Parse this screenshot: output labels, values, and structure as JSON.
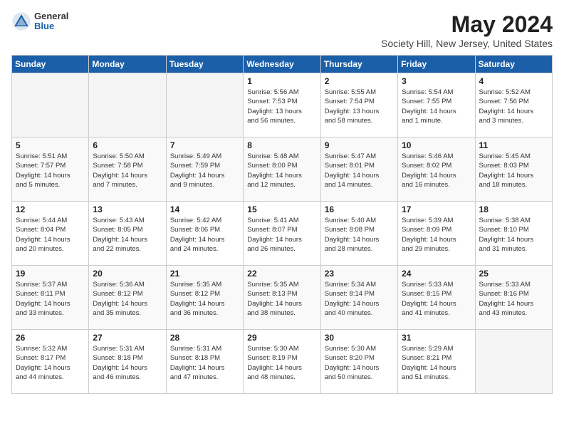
{
  "header": {
    "logo_line1": "General",
    "logo_line2": "Blue",
    "month_year": "May 2024",
    "location": "Society Hill, New Jersey, United States"
  },
  "days_of_week": [
    "Sunday",
    "Monday",
    "Tuesday",
    "Wednesday",
    "Thursday",
    "Friday",
    "Saturday"
  ],
  "weeks": [
    [
      {
        "day": "",
        "info": ""
      },
      {
        "day": "",
        "info": ""
      },
      {
        "day": "",
        "info": ""
      },
      {
        "day": "1",
        "info": "Sunrise: 5:56 AM\nSunset: 7:53 PM\nDaylight: 13 hours\nand 56 minutes."
      },
      {
        "day": "2",
        "info": "Sunrise: 5:55 AM\nSunset: 7:54 PM\nDaylight: 13 hours\nand 58 minutes."
      },
      {
        "day": "3",
        "info": "Sunrise: 5:54 AM\nSunset: 7:55 PM\nDaylight: 14 hours\nand 1 minute."
      },
      {
        "day": "4",
        "info": "Sunrise: 5:52 AM\nSunset: 7:56 PM\nDaylight: 14 hours\nand 3 minutes."
      }
    ],
    [
      {
        "day": "5",
        "info": "Sunrise: 5:51 AM\nSunset: 7:57 PM\nDaylight: 14 hours\nand 5 minutes."
      },
      {
        "day": "6",
        "info": "Sunrise: 5:50 AM\nSunset: 7:58 PM\nDaylight: 14 hours\nand 7 minutes."
      },
      {
        "day": "7",
        "info": "Sunrise: 5:49 AM\nSunset: 7:59 PM\nDaylight: 14 hours\nand 9 minutes."
      },
      {
        "day": "8",
        "info": "Sunrise: 5:48 AM\nSunset: 8:00 PM\nDaylight: 14 hours\nand 12 minutes."
      },
      {
        "day": "9",
        "info": "Sunrise: 5:47 AM\nSunset: 8:01 PM\nDaylight: 14 hours\nand 14 minutes."
      },
      {
        "day": "10",
        "info": "Sunrise: 5:46 AM\nSunset: 8:02 PM\nDaylight: 14 hours\nand 16 minutes."
      },
      {
        "day": "11",
        "info": "Sunrise: 5:45 AM\nSunset: 8:03 PM\nDaylight: 14 hours\nand 18 minutes."
      }
    ],
    [
      {
        "day": "12",
        "info": "Sunrise: 5:44 AM\nSunset: 8:04 PM\nDaylight: 14 hours\nand 20 minutes."
      },
      {
        "day": "13",
        "info": "Sunrise: 5:43 AM\nSunset: 8:05 PM\nDaylight: 14 hours\nand 22 minutes."
      },
      {
        "day": "14",
        "info": "Sunrise: 5:42 AM\nSunset: 8:06 PM\nDaylight: 14 hours\nand 24 minutes."
      },
      {
        "day": "15",
        "info": "Sunrise: 5:41 AM\nSunset: 8:07 PM\nDaylight: 14 hours\nand 26 minutes."
      },
      {
        "day": "16",
        "info": "Sunrise: 5:40 AM\nSunset: 8:08 PM\nDaylight: 14 hours\nand 28 minutes."
      },
      {
        "day": "17",
        "info": "Sunrise: 5:39 AM\nSunset: 8:09 PM\nDaylight: 14 hours\nand 29 minutes."
      },
      {
        "day": "18",
        "info": "Sunrise: 5:38 AM\nSunset: 8:10 PM\nDaylight: 14 hours\nand 31 minutes."
      }
    ],
    [
      {
        "day": "19",
        "info": "Sunrise: 5:37 AM\nSunset: 8:11 PM\nDaylight: 14 hours\nand 33 minutes."
      },
      {
        "day": "20",
        "info": "Sunrise: 5:36 AM\nSunset: 8:12 PM\nDaylight: 14 hours\nand 35 minutes."
      },
      {
        "day": "21",
        "info": "Sunrise: 5:35 AM\nSunset: 8:12 PM\nDaylight: 14 hours\nand 36 minutes."
      },
      {
        "day": "22",
        "info": "Sunrise: 5:35 AM\nSunset: 8:13 PM\nDaylight: 14 hours\nand 38 minutes."
      },
      {
        "day": "23",
        "info": "Sunrise: 5:34 AM\nSunset: 8:14 PM\nDaylight: 14 hours\nand 40 minutes."
      },
      {
        "day": "24",
        "info": "Sunrise: 5:33 AM\nSunset: 8:15 PM\nDaylight: 14 hours\nand 41 minutes."
      },
      {
        "day": "25",
        "info": "Sunrise: 5:33 AM\nSunset: 8:16 PM\nDaylight: 14 hours\nand 43 minutes."
      }
    ],
    [
      {
        "day": "26",
        "info": "Sunrise: 5:32 AM\nSunset: 8:17 PM\nDaylight: 14 hours\nand 44 minutes."
      },
      {
        "day": "27",
        "info": "Sunrise: 5:31 AM\nSunset: 8:18 PM\nDaylight: 14 hours\nand 46 minutes."
      },
      {
        "day": "28",
        "info": "Sunrise: 5:31 AM\nSunset: 8:18 PM\nDaylight: 14 hours\nand 47 minutes."
      },
      {
        "day": "29",
        "info": "Sunrise: 5:30 AM\nSunset: 8:19 PM\nDaylight: 14 hours\nand 48 minutes."
      },
      {
        "day": "30",
        "info": "Sunrise: 5:30 AM\nSunset: 8:20 PM\nDaylight: 14 hours\nand 50 minutes."
      },
      {
        "day": "31",
        "info": "Sunrise: 5:29 AM\nSunset: 8:21 PM\nDaylight: 14 hours\nand 51 minutes."
      },
      {
        "day": "",
        "info": ""
      }
    ]
  ]
}
